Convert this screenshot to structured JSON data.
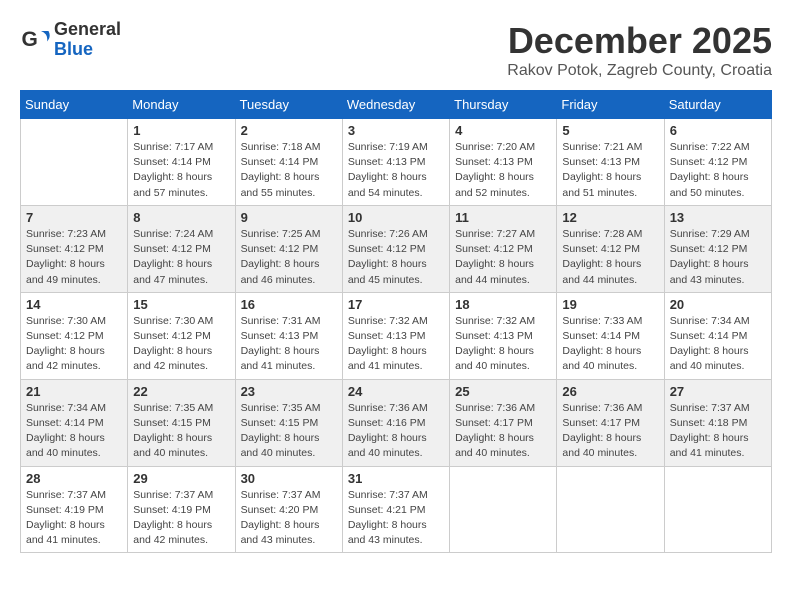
{
  "logo": {
    "general": "General",
    "blue": "Blue"
  },
  "header": {
    "month": "December 2025",
    "location": "Rakov Potok, Zagreb County, Croatia"
  },
  "weekdays": [
    "Sunday",
    "Monday",
    "Tuesday",
    "Wednesday",
    "Thursday",
    "Friday",
    "Saturday"
  ],
  "weeks": [
    [
      {
        "day": "",
        "info": ""
      },
      {
        "day": "1",
        "info": "Sunrise: 7:17 AM\nSunset: 4:14 PM\nDaylight: 8 hours\nand 57 minutes."
      },
      {
        "day": "2",
        "info": "Sunrise: 7:18 AM\nSunset: 4:14 PM\nDaylight: 8 hours\nand 55 minutes."
      },
      {
        "day": "3",
        "info": "Sunrise: 7:19 AM\nSunset: 4:13 PM\nDaylight: 8 hours\nand 54 minutes."
      },
      {
        "day": "4",
        "info": "Sunrise: 7:20 AM\nSunset: 4:13 PM\nDaylight: 8 hours\nand 52 minutes."
      },
      {
        "day": "5",
        "info": "Sunrise: 7:21 AM\nSunset: 4:13 PM\nDaylight: 8 hours\nand 51 minutes."
      },
      {
        "day": "6",
        "info": "Sunrise: 7:22 AM\nSunset: 4:12 PM\nDaylight: 8 hours\nand 50 minutes."
      }
    ],
    [
      {
        "day": "7",
        "info": "Sunrise: 7:23 AM\nSunset: 4:12 PM\nDaylight: 8 hours\nand 49 minutes."
      },
      {
        "day": "8",
        "info": "Sunrise: 7:24 AM\nSunset: 4:12 PM\nDaylight: 8 hours\nand 47 minutes."
      },
      {
        "day": "9",
        "info": "Sunrise: 7:25 AM\nSunset: 4:12 PM\nDaylight: 8 hours\nand 46 minutes."
      },
      {
        "day": "10",
        "info": "Sunrise: 7:26 AM\nSunset: 4:12 PM\nDaylight: 8 hours\nand 45 minutes."
      },
      {
        "day": "11",
        "info": "Sunrise: 7:27 AM\nSunset: 4:12 PM\nDaylight: 8 hours\nand 44 minutes."
      },
      {
        "day": "12",
        "info": "Sunrise: 7:28 AM\nSunset: 4:12 PM\nDaylight: 8 hours\nand 44 minutes."
      },
      {
        "day": "13",
        "info": "Sunrise: 7:29 AM\nSunset: 4:12 PM\nDaylight: 8 hours\nand 43 minutes."
      }
    ],
    [
      {
        "day": "14",
        "info": "Sunrise: 7:30 AM\nSunset: 4:12 PM\nDaylight: 8 hours\nand 42 minutes."
      },
      {
        "day": "15",
        "info": "Sunrise: 7:30 AM\nSunset: 4:12 PM\nDaylight: 8 hours\nand 42 minutes."
      },
      {
        "day": "16",
        "info": "Sunrise: 7:31 AM\nSunset: 4:13 PM\nDaylight: 8 hours\nand 41 minutes."
      },
      {
        "day": "17",
        "info": "Sunrise: 7:32 AM\nSunset: 4:13 PM\nDaylight: 8 hours\nand 41 minutes."
      },
      {
        "day": "18",
        "info": "Sunrise: 7:32 AM\nSunset: 4:13 PM\nDaylight: 8 hours\nand 40 minutes."
      },
      {
        "day": "19",
        "info": "Sunrise: 7:33 AM\nSunset: 4:14 PM\nDaylight: 8 hours\nand 40 minutes."
      },
      {
        "day": "20",
        "info": "Sunrise: 7:34 AM\nSunset: 4:14 PM\nDaylight: 8 hours\nand 40 minutes."
      }
    ],
    [
      {
        "day": "21",
        "info": "Sunrise: 7:34 AM\nSunset: 4:14 PM\nDaylight: 8 hours\nand 40 minutes."
      },
      {
        "day": "22",
        "info": "Sunrise: 7:35 AM\nSunset: 4:15 PM\nDaylight: 8 hours\nand 40 minutes."
      },
      {
        "day": "23",
        "info": "Sunrise: 7:35 AM\nSunset: 4:15 PM\nDaylight: 8 hours\nand 40 minutes."
      },
      {
        "day": "24",
        "info": "Sunrise: 7:36 AM\nSunset: 4:16 PM\nDaylight: 8 hours\nand 40 minutes."
      },
      {
        "day": "25",
        "info": "Sunrise: 7:36 AM\nSunset: 4:17 PM\nDaylight: 8 hours\nand 40 minutes."
      },
      {
        "day": "26",
        "info": "Sunrise: 7:36 AM\nSunset: 4:17 PM\nDaylight: 8 hours\nand 40 minutes."
      },
      {
        "day": "27",
        "info": "Sunrise: 7:37 AM\nSunset: 4:18 PM\nDaylight: 8 hours\nand 41 minutes."
      }
    ],
    [
      {
        "day": "28",
        "info": "Sunrise: 7:37 AM\nSunset: 4:19 PM\nDaylight: 8 hours\nand 41 minutes."
      },
      {
        "day": "29",
        "info": "Sunrise: 7:37 AM\nSunset: 4:19 PM\nDaylight: 8 hours\nand 42 minutes."
      },
      {
        "day": "30",
        "info": "Sunrise: 7:37 AM\nSunset: 4:20 PM\nDaylight: 8 hours\nand 43 minutes."
      },
      {
        "day": "31",
        "info": "Sunrise: 7:37 AM\nSunset: 4:21 PM\nDaylight: 8 hours\nand 43 minutes."
      },
      {
        "day": "",
        "info": ""
      },
      {
        "day": "",
        "info": ""
      },
      {
        "day": "",
        "info": ""
      }
    ]
  ]
}
